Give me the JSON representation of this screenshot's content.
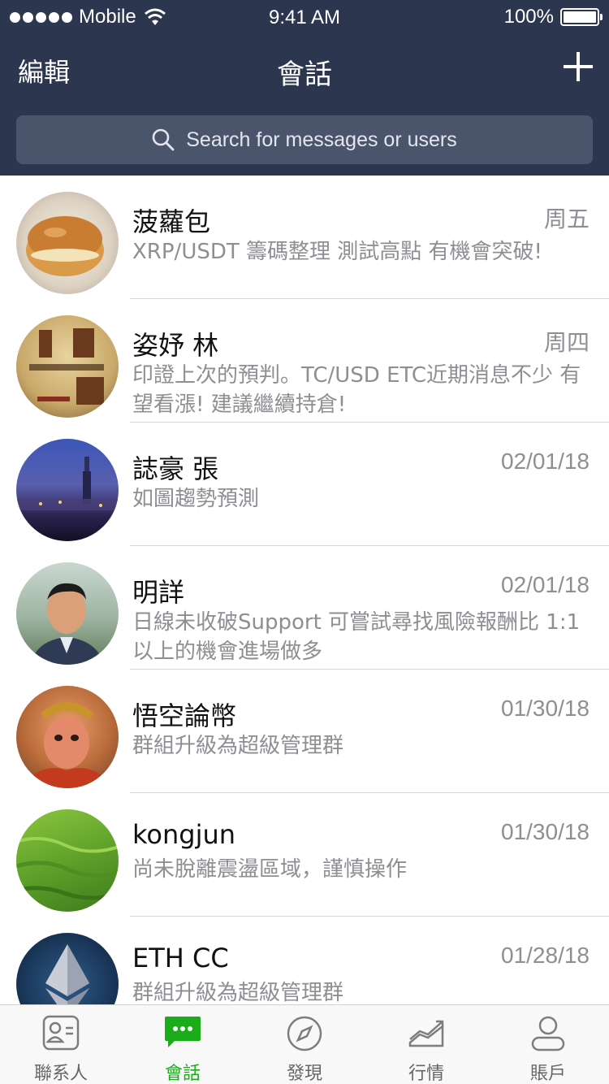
{
  "status_bar": {
    "carrier": "Mobile",
    "time": "9:41 AM",
    "battery": "100%"
  },
  "nav": {
    "edit_label": "編輯",
    "title": "會話"
  },
  "search": {
    "placeholder": "Search for messages or users"
  },
  "chats": [
    {
      "name": "菠蘿包",
      "date": "周五",
      "preview": "XRP/USDT 籌碼整理 測試高點 有機會突破!"
    },
    {
      "name": "姿妤 林",
      "date": "周四",
      "preview": "印證上次的預判。TC/USD ETC近期消息不少 有望看漲! 建議繼續持倉!"
    },
    {
      "name": "誌豪 張",
      "date": "02/01/18",
      "preview": "如圖趨勢預測"
    },
    {
      "name": "明詳",
      "date": "02/01/18",
      "preview": "日線未收破Support 可嘗試尋找風險報酬比 1:1以上的機會進場做多"
    },
    {
      "name": "悟空論幣",
      "date": "01/30/18",
      "preview": "群組升級為超級管理群"
    },
    {
      "name": "kongjun",
      "date": "01/30/18",
      "preview": "尚未脫離震盪區域，謹慎操作"
    },
    {
      "name": "ETH CC",
      "date": "01/28/18",
      "preview": "群組升級為超級管理群"
    }
  ],
  "tabs": [
    {
      "label": "聯系人",
      "icon": "contacts-icon"
    },
    {
      "label": "會話",
      "icon": "chat-icon"
    },
    {
      "label": "發現",
      "icon": "compass-icon"
    },
    {
      "label": "行情",
      "icon": "chart-icon"
    },
    {
      "label": "賬戶",
      "icon": "person-icon"
    }
  ],
  "colors": {
    "header": "#2c364f",
    "active_tab": "#1aad19"
  }
}
